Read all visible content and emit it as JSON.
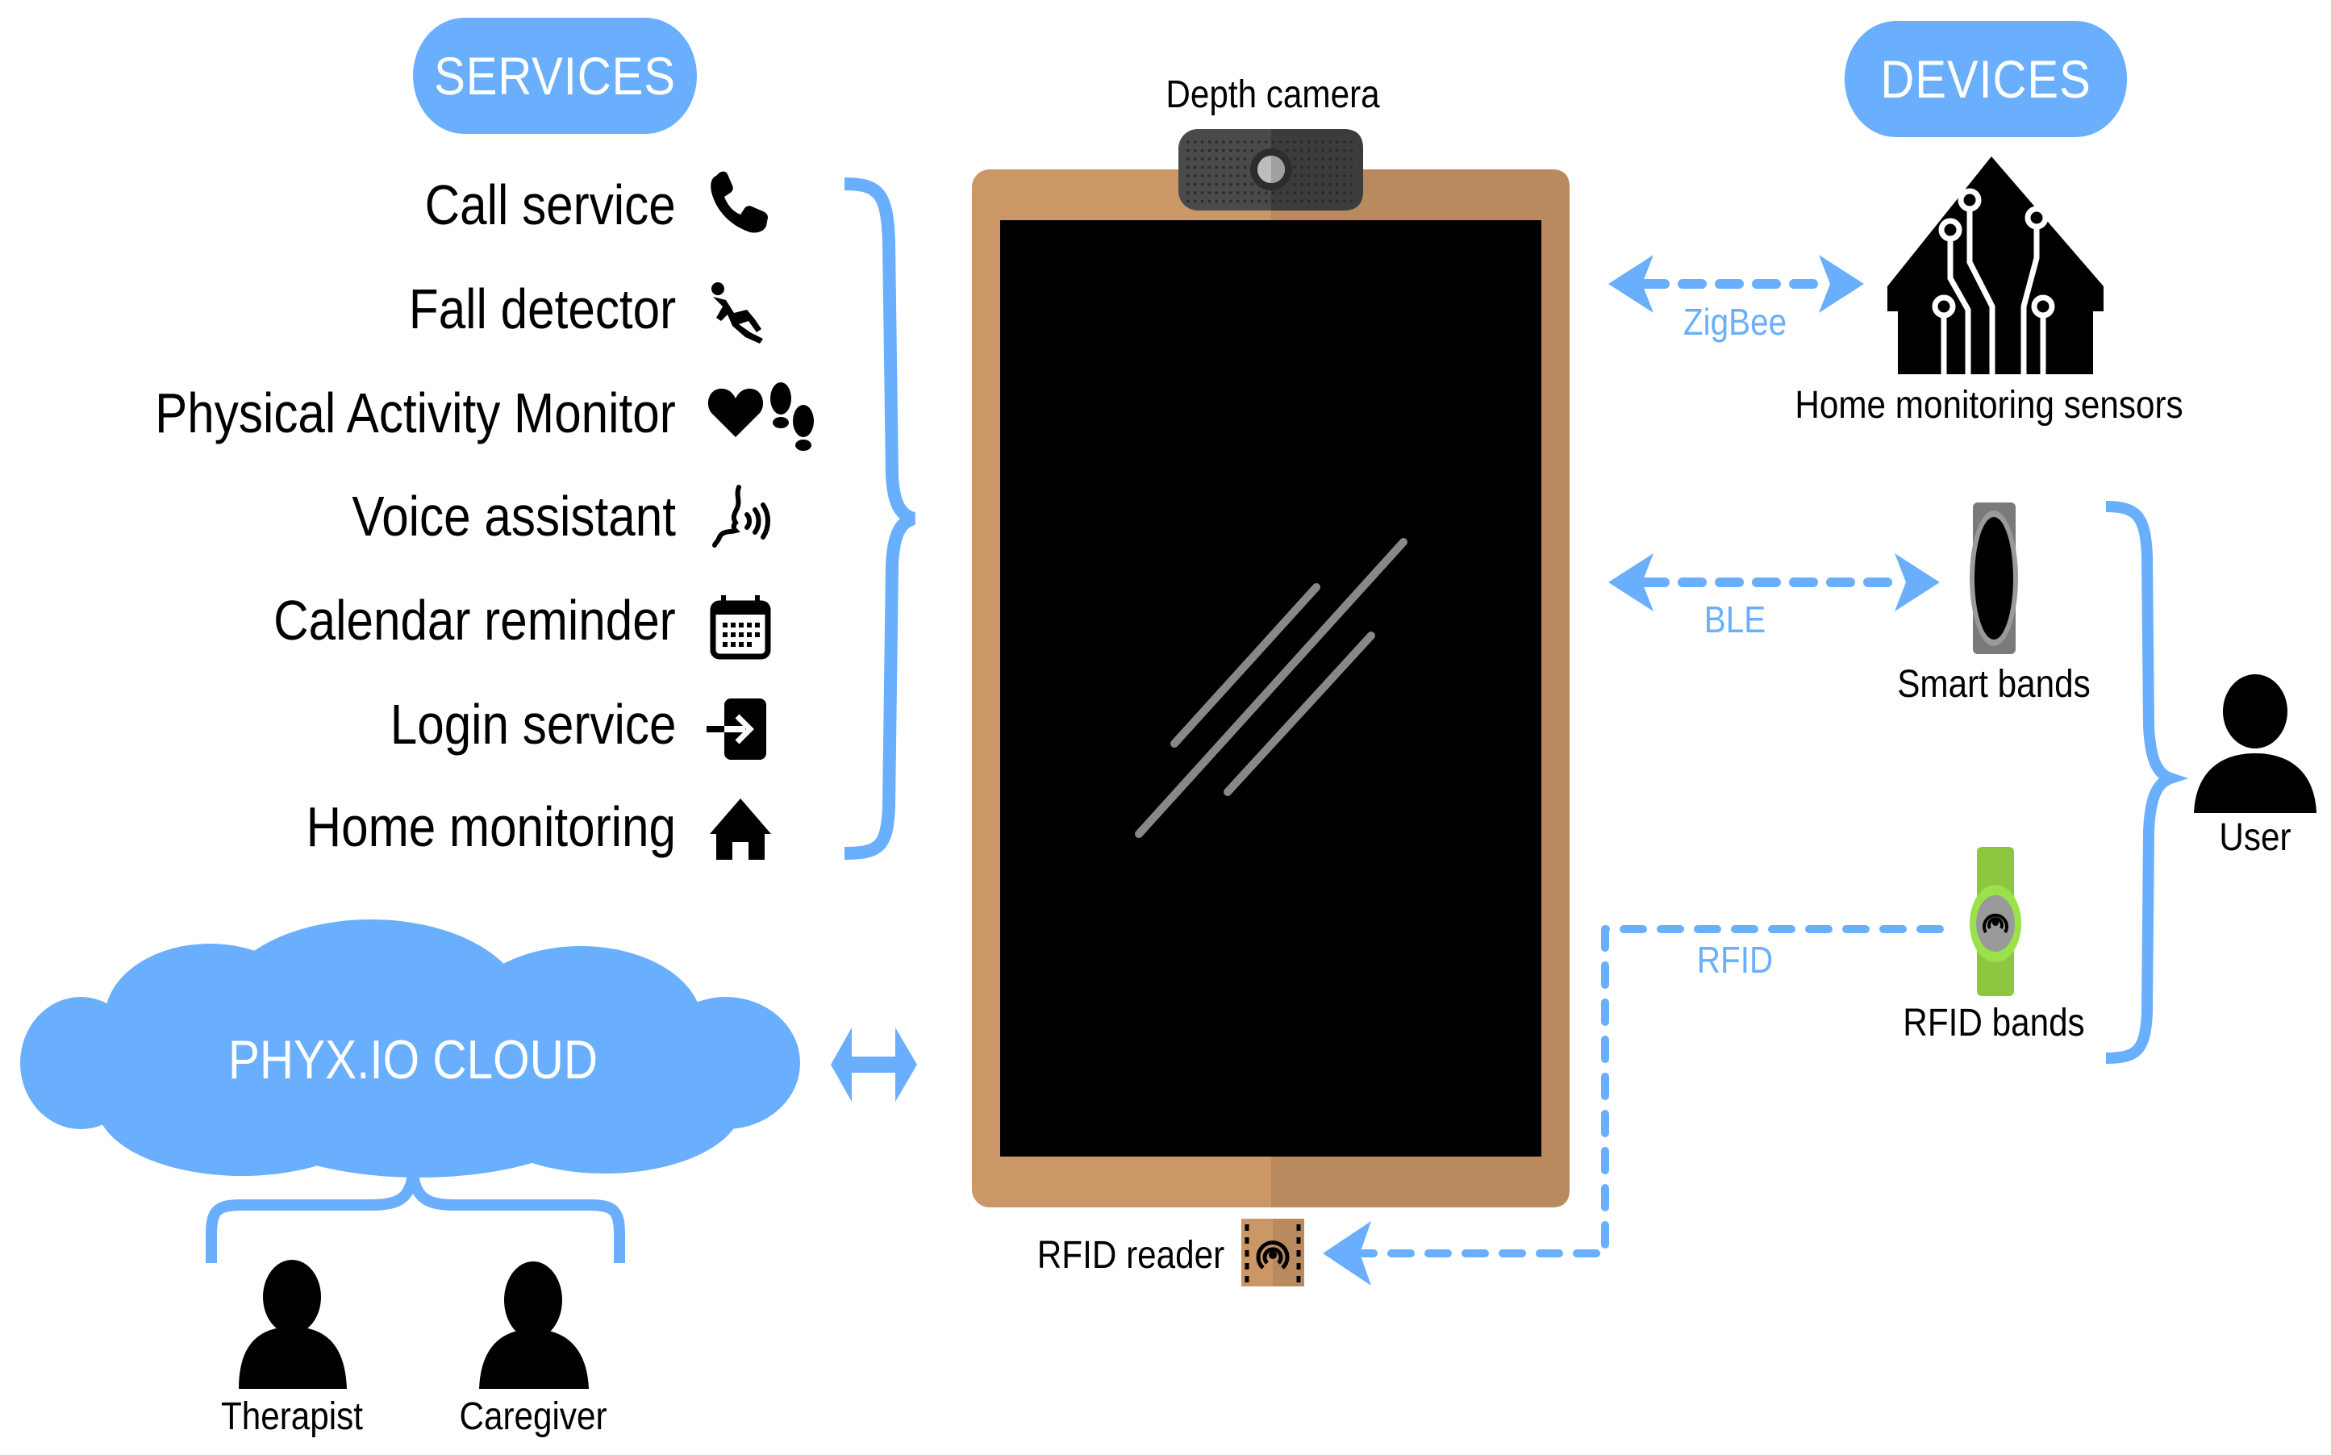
{
  "services": {
    "header": "SERVICES",
    "items": [
      {
        "label": "Call service",
        "icon": "phone-icon"
      },
      {
        "label": "Fall detector",
        "icon": "falling-person-icon"
      },
      {
        "label": "Physical Activity Monitor",
        "icon": "heart-footprints-icon"
      },
      {
        "label": "Voice assistant",
        "icon": "speaking-head-icon"
      },
      {
        "label": "Calendar reminder",
        "icon": "calendar-icon"
      },
      {
        "label": "Login service",
        "icon": "login-icon"
      },
      {
        "label": "Home monitoring",
        "icon": "home-icon"
      }
    ]
  },
  "devices": {
    "header": "DEVICES",
    "home_sensors": {
      "label": "Home monitoring sensors",
      "link": "ZigBee"
    },
    "smart_bands": {
      "label": "Smart bands",
      "link": "BLE"
    },
    "rfid_bands": {
      "label": "RFID bands",
      "link": "RFID"
    }
  },
  "tablet": {
    "camera_label": "Depth camera",
    "reader_label": "RFID reader"
  },
  "cloud": {
    "label": "PHYX.IO CLOUD",
    "people": [
      {
        "label": "Therapist"
      },
      {
        "label": "Caregiver"
      }
    ]
  },
  "user": {
    "label": "User"
  },
  "colors": {
    "accent": "#6aaffd",
    "tablet_frame_light": "#cb9766",
    "tablet_frame_dark": "#b98a5e",
    "screen": "#000000",
    "band_green": "#8dc63f",
    "band_grey": "#808080"
  }
}
